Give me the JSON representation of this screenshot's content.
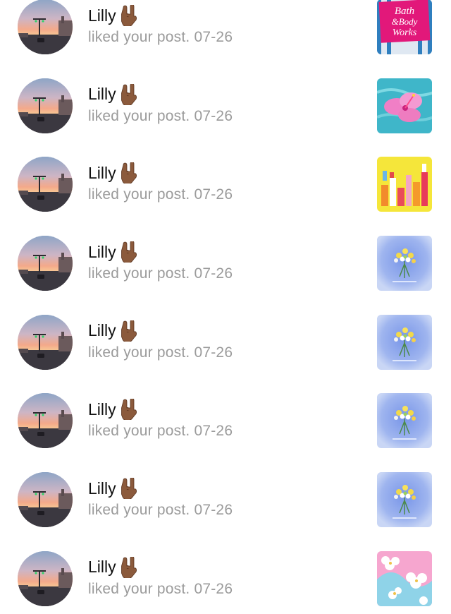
{
  "notifications": [
    {
      "user": "Lilly",
      "action": "liked your post.",
      "date": "07-26",
      "thumbnail": "bath-body-works-logo",
      "thumb_text": [
        "Bath",
        "&Body",
        "Works"
      ]
    },
    {
      "user": "Lilly",
      "action": "liked your post.",
      "date": "07-26",
      "thumbnail": "pink-hibiscus-in-water"
    },
    {
      "user": "Lilly",
      "action": "liked your post.",
      "date": "07-26",
      "thumbnail": "colorful-products-yellow"
    },
    {
      "user": "Lilly",
      "action": "liked your post.",
      "date": "07-26",
      "thumbnail": "flower-bouquet-blue"
    },
    {
      "user": "Lilly",
      "action": "liked your post.",
      "date": "07-26",
      "thumbnail": "flower-bouquet-blue"
    },
    {
      "user": "Lilly",
      "action": "liked your post.",
      "date": "07-26",
      "thumbnail": "flower-bouquet-blue"
    },
    {
      "user": "Lilly",
      "action": "liked your post.",
      "date": "07-26",
      "thumbnail": "flower-bouquet-blue"
    },
    {
      "user": "Lilly",
      "action": "liked your post.",
      "date": "07-26",
      "thumbnail": "hibiscus-pattern-pink-blue"
    }
  ],
  "icons": {
    "emoji": "rock-on-hand-icon"
  }
}
